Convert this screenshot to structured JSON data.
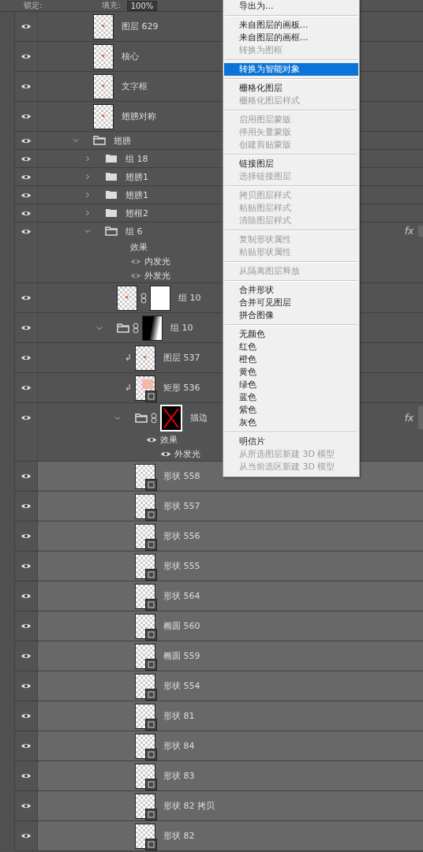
{
  "toolbar": {
    "lock_label": "锁定:",
    "fill_label": "填充:",
    "fill_value": "100%"
  },
  "layers": [
    {
      "name": "图层 629",
      "kind": "layer",
      "thumb": {
        "kind": "checker-mark"
      },
      "selected": false
    },
    {
      "name": "核心",
      "kind": "layer",
      "thumb": {
        "kind": "checker-mark"
      },
      "selected": false
    },
    {
      "name": "文字框",
      "kind": "layer",
      "thumb": {
        "kind": "checker-mark"
      },
      "selected": false
    },
    {
      "name": "翅膀对称",
      "kind": "layer",
      "thumb": {
        "kind": "checker-mark"
      },
      "selected": false
    },
    {
      "name": "翅膀",
      "kind": "group",
      "expanded": true,
      "selected": false,
      "children": [
        {
          "name": "组 18",
          "kind": "group",
          "expanded": false,
          "selected": false
        },
        {
          "name": "翅膀1",
          "kind": "group",
          "expanded": false,
          "selected": false
        },
        {
          "name": "翅膀1",
          "kind": "group",
          "expanded": false,
          "selected": false
        },
        {
          "name": "翅根2",
          "kind": "group",
          "expanded": false,
          "selected": false
        },
        {
          "name": "组 6",
          "kind": "group",
          "expanded": true,
          "selected": false,
          "fx": "fx",
          "effects": {
            "label": "效果",
            "has_eye": false,
            "items": [
              {
                "label": "内发光",
                "visible": false
              },
              {
                "label": "外发光",
                "visible": false
              }
            ]
          },
          "children": [
            {
              "name": "组 10",
              "kind": "layer",
              "thumb": {
                "kind": "checker-mark"
              },
              "mask": {
                "kind": "white"
              },
              "selected": false
            },
            {
              "name": "组 10",
              "kind": "group",
              "expanded": true,
              "mask": {
                "kind": "gradient"
              },
              "selected": false,
              "children": [
                {
                  "name": "图层 537",
                  "kind": "layer",
                  "thumb": {
                    "kind": "checker-mark"
                  },
                  "clipped": true,
                  "selected": false
                },
                {
                  "name": "矩形 536",
                  "kind": "layer",
                  "thumb": {
                    "kind": "pink"
                  },
                  "shape": true,
                  "clipped": true,
                  "selected": false
                },
                {
                  "name": "描边",
                  "kind": "group",
                  "expanded": true,
                  "mask": {
                    "kind": "cross"
                  },
                  "selected": false,
                  "fx": "fx",
                  "effects": {
                    "label": "效果",
                    "has_eye": true,
                    "items": [
                      {
                        "label": "外发光",
                        "visible": true
                      }
                    ]
                  }
                },
                {
                  "name": "形状 558",
                  "kind": "layer",
                  "thumb": {
                    "kind": "checker"
                  },
                  "shape": true,
                  "selected": true
                },
                {
                  "name": "形状 557",
                  "kind": "layer",
                  "thumb": {
                    "kind": "checker"
                  },
                  "shape": true,
                  "selected": true
                },
                {
                  "name": "形状 556",
                  "kind": "layer",
                  "thumb": {
                    "kind": "checker"
                  },
                  "shape": true,
                  "selected": true
                },
                {
                  "name": "形状 555",
                  "kind": "layer",
                  "thumb": {
                    "kind": "checker"
                  },
                  "shape": true,
                  "selected": true
                },
                {
                  "name": "形状 564",
                  "kind": "layer",
                  "thumb": {
                    "kind": "checker"
                  },
                  "shape": true,
                  "selected": true
                },
                {
                  "name": "椭圆 560",
                  "kind": "layer",
                  "thumb": {
                    "kind": "checker"
                  },
                  "shape": true,
                  "selected": true
                },
                {
                  "name": "椭圆 559",
                  "kind": "layer",
                  "thumb": {
                    "kind": "checker"
                  },
                  "shape": true,
                  "selected": true
                },
                {
                  "name": "形状 554",
                  "kind": "layer",
                  "thumb": {
                    "kind": "checker"
                  },
                  "shape": true,
                  "selected": true
                },
                {
                  "name": "形状 81",
                  "kind": "layer",
                  "thumb": {
                    "kind": "checker"
                  },
                  "shape": true,
                  "selected": true
                },
                {
                  "name": "形状 84",
                  "kind": "layer",
                  "thumb": {
                    "kind": "checker"
                  },
                  "shape": true,
                  "selected": true
                },
                {
                  "name": "形状 83",
                  "kind": "layer",
                  "thumb": {
                    "kind": "checker"
                  },
                  "shape": true,
                  "selected": true
                },
                {
                  "name": "形状 82 拷贝",
                  "kind": "layer",
                  "thumb": {
                    "kind": "checker"
                  },
                  "shape": true,
                  "selected": true
                },
                {
                  "name": "形状 82",
                  "kind": "layer",
                  "thumb": {
                    "kind": "checker"
                  },
                  "shape": true,
                  "selected": true
                }
              ]
            }
          ]
        }
      ]
    }
  ],
  "context_menu": {
    "sections": [
      {
        "items": [
          {
            "label": "导出为...",
            "disabled": false,
            "selected": false
          }
        ]
      },
      {
        "items": [
          {
            "label": "来自图层的画板...",
            "disabled": false,
            "selected": false
          },
          {
            "label": "来自图层的画框...",
            "disabled": false,
            "selected": false
          },
          {
            "label": "转换为图框",
            "disabled": true,
            "selected": false
          }
        ]
      },
      {
        "items": [
          {
            "label": "转换为智能对象",
            "disabled": false,
            "selected": true
          }
        ]
      },
      {
        "items": [
          {
            "label": "栅格化图层",
            "disabled": false,
            "selected": false
          },
          {
            "label": "栅格化图层样式",
            "disabled": true,
            "selected": false
          }
        ]
      },
      {
        "items": [
          {
            "label": "启用图层蒙版",
            "disabled": true,
            "selected": false
          },
          {
            "label": "停用矢量蒙版",
            "disabled": true,
            "selected": false
          },
          {
            "label": "创建剪贴蒙版",
            "disabled": true,
            "selected": false
          }
        ]
      },
      {
        "items": [
          {
            "label": "链接图层",
            "disabled": false,
            "selected": false
          },
          {
            "label": "选择链接图层",
            "disabled": true,
            "selected": false
          }
        ]
      },
      {
        "items": [
          {
            "label": "拷贝图层样式",
            "disabled": true,
            "selected": false
          },
          {
            "label": "粘贴图层样式",
            "disabled": true,
            "selected": false
          },
          {
            "label": "清除图层样式",
            "disabled": true,
            "selected": false
          }
        ]
      },
      {
        "items": [
          {
            "label": "复制形状属性",
            "disabled": true,
            "selected": false
          },
          {
            "label": "粘贴形状属性",
            "disabled": true,
            "selected": false
          }
        ]
      },
      {
        "items": [
          {
            "label": "从隔离图层释放",
            "disabled": true,
            "selected": false
          }
        ]
      },
      {
        "items": [
          {
            "label": "合并形状",
            "disabled": false,
            "selected": false
          },
          {
            "label": "合并可见图层",
            "disabled": false,
            "selected": false
          },
          {
            "label": "拼合图像",
            "disabled": false,
            "selected": false
          }
        ]
      },
      {
        "items": [
          {
            "label": "无颜色",
            "disabled": false,
            "selected": false
          },
          {
            "label": "红色",
            "disabled": false,
            "selected": false
          },
          {
            "label": "橙色",
            "disabled": false,
            "selected": false
          },
          {
            "label": "黄色",
            "disabled": false,
            "selected": false
          },
          {
            "label": "绿色",
            "disabled": false,
            "selected": false
          },
          {
            "label": "蓝色",
            "disabled": false,
            "selected": false
          },
          {
            "label": "紫色",
            "disabled": false,
            "selected": false
          },
          {
            "label": "灰色",
            "disabled": false,
            "selected": false
          }
        ]
      },
      {
        "items": [
          {
            "label": "明信片",
            "disabled": false,
            "selected": false
          },
          {
            "label": "从所选图层新建 3D 模型",
            "disabled": true,
            "selected": false
          },
          {
            "label": "从当前选区新建 3D 模型",
            "disabled": true,
            "selected": false
          }
        ]
      }
    ]
  }
}
